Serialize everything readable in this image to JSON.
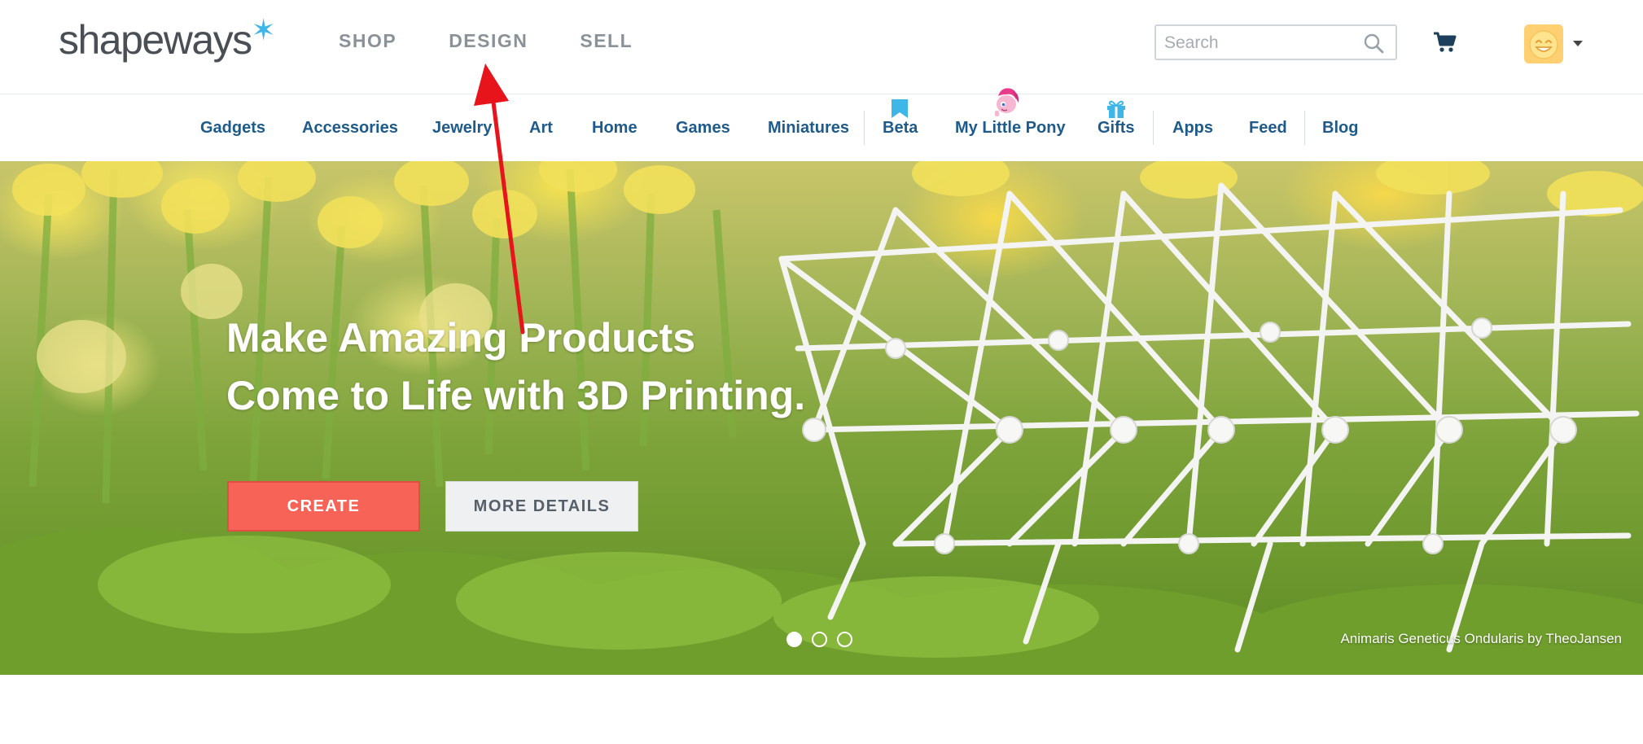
{
  "header": {
    "logo_text": "shapeways",
    "logo_star": "✶",
    "nav": [
      {
        "label": "SHOP"
      },
      {
        "label": "DESIGN"
      },
      {
        "label": "SELL"
      }
    ],
    "search": {
      "placeholder": "Search",
      "icon": "search-icon"
    },
    "cart_icon": "cart-icon",
    "avatar_icon": "smiley-avatar-icon"
  },
  "categories": [
    {
      "label": "Gadgets"
    },
    {
      "label": "Accessories"
    },
    {
      "label": "Jewelry"
    },
    {
      "label": "Art"
    },
    {
      "label": "Home"
    },
    {
      "label": "Games"
    },
    {
      "label": "Miniatures"
    },
    {
      "label": "Beta",
      "icon": "bookmark-icon"
    },
    {
      "label": "My Little Pony",
      "icon": "pony-icon"
    },
    {
      "label": "Gifts",
      "icon": "gift-icon"
    },
    {
      "label": "Apps"
    },
    {
      "label": "Feed"
    },
    {
      "label": "Blog"
    }
  ],
  "hero": {
    "title_line1": "Make Amazing Products",
    "title_line2": "Come to Life with 3D Printing.",
    "create_label": "CREATE",
    "more_label": "MORE DETAILS",
    "caption": "Animaris Geneticus Ondularis by TheoJansen",
    "slides": 3,
    "active_slide": 1
  },
  "colors": {
    "brand_star": "#3fb6e8",
    "category_text": "#1e5a8a",
    "create_button": "#f76357",
    "nav_text": "#8a9199",
    "annotation_arrow": "#e8141b"
  }
}
